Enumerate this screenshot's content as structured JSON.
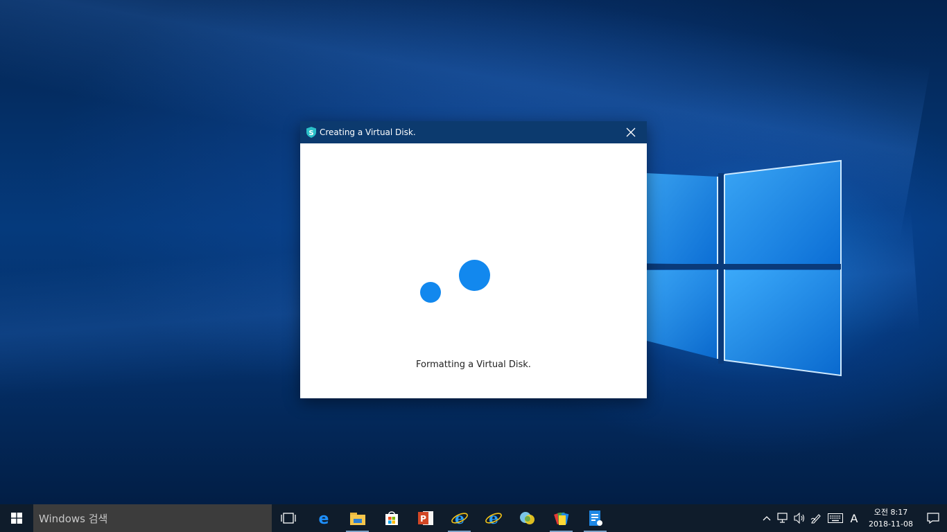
{
  "dialog": {
    "title": "Creating a Virtual Disk.",
    "status": "Formatting a Virtual Disk.",
    "icon": "shield-s-app-icon",
    "accent": "#1288ee",
    "titlebar_color": "#0c3a6e"
  },
  "taskbar": {
    "search_placeholder": "Windows 검색",
    "pinned_apps": [
      {
        "name": "Microsoft Edge",
        "icon": "edge-icon",
        "running": false
      },
      {
        "name": "File Explorer",
        "icon": "file-explorer-icon",
        "running": true
      },
      {
        "name": "Microsoft Store",
        "icon": "store-icon",
        "running": false
      },
      {
        "name": "PowerPoint",
        "icon": "powerpoint-icon",
        "running": false
      },
      {
        "name": "Internet Explorer",
        "icon": "internet-explorer-icon",
        "running": true
      },
      {
        "name": "Internet Explorer",
        "icon": "internet-explorer-icon",
        "running": false
      },
      {
        "name": "App",
        "icon": "circles-app-icon",
        "running": false
      },
      {
        "name": "App",
        "icon": "cards-app-icon",
        "running": true
      },
      {
        "name": "Document",
        "icon": "document-app-icon",
        "running": true
      }
    ],
    "tray": {
      "ime": "A",
      "time": "오전 8:17",
      "date": "2018-11-08"
    }
  }
}
